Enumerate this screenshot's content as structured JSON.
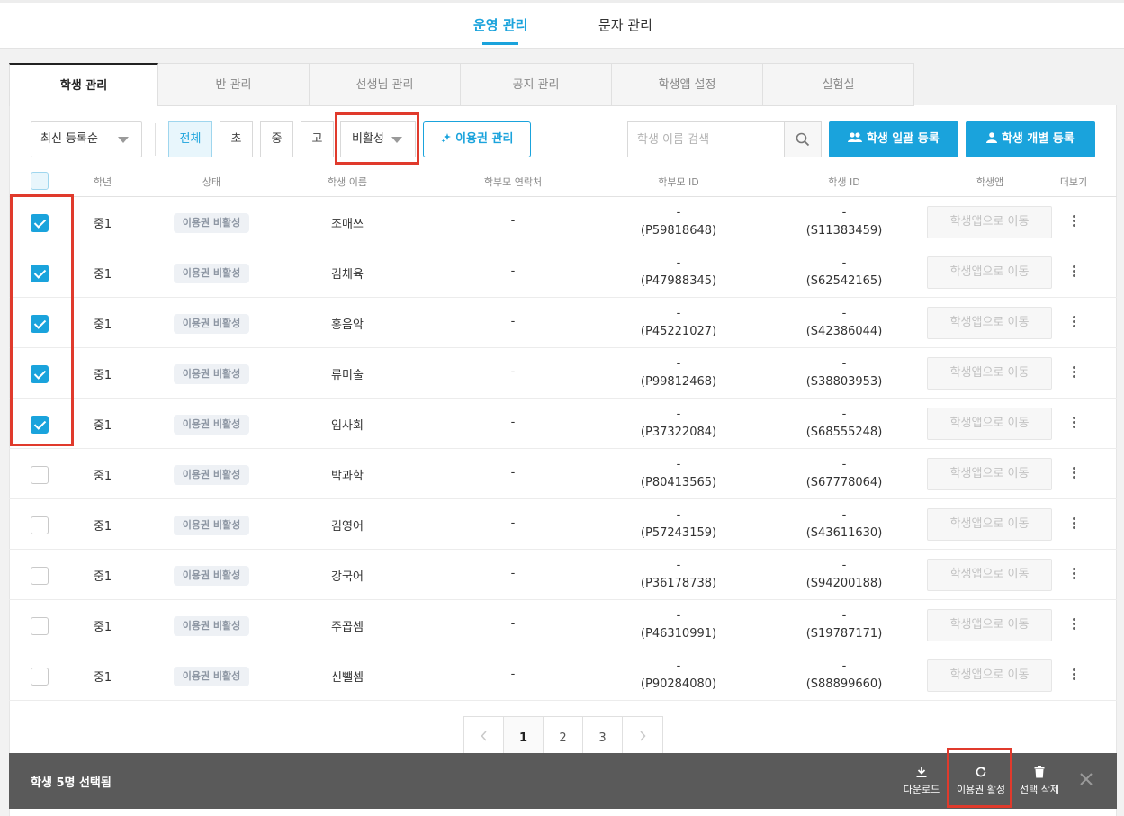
{
  "top_nav": {
    "items": [
      "운영 관리",
      "문자 관리"
    ],
    "active": "운영 관리"
  },
  "tabs": [
    "학생 관리",
    "반 관리",
    "선생님 관리",
    "공지 관리",
    "학생앱 설정",
    "실험실"
  ],
  "toolbar": {
    "sort_value": "최신 등록순",
    "grades": [
      "전체",
      "초",
      "중",
      "고"
    ],
    "status_value": "비활성",
    "pass_button": "이용권 관리",
    "search_placeholder": "학생 이름 검색",
    "bulk_register": "학생 일괄 등록",
    "single_register": "학생 개별 등록"
  },
  "table": {
    "headers": [
      "학년",
      "상태",
      "학생 이름",
      "학부모 연락처",
      "학부모 ID",
      "학생 ID",
      "학생앱",
      "더보기"
    ],
    "rows": [
      {
        "checked": true,
        "grade": "중1",
        "status": "이용권 비활성",
        "name": "조매쓰",
        "parent_phone": "-",
        "parent_id_top": "-",
        "parent_id": "(P59818648)",
        "student_id_top": "-",
        "student_id": "(S11383459)",
        "app_button": "학생앱으로 이동"
      },
      {
        "checked": true,
        "grade": "중1",
        "status": "이용권 비활성",
        "name": "김체육",
        "parent_phone": "-",
        "parent_id_top": "-",
        "parent_id": "(P47988345)",
        "student_id_top": "-",
        "student_id": "(S62542165)",
        "app_button": "학생앱으로 이동"
      },
      {
        "checked": true,
        "grade": "중1",
        "status": "이용권 비활성",
        "name": "홍음악",
        "parent_phone": "-",
        "parent_id_top": "-",
        "parent_id": "(P45221027)",
        "student_id_top": "-",
        "student_id": "(S42386044)",
        "app_button": "학생앱으로 이동"
      },
      {
        "checked": true,
        "grade": "중1",
        "status": "이용권 비활성",
        "name": "류미술",
        "parent_phone": "-",
        "parent_id_top": "-",
        "parent_id": "(P99812468)",
        "student_id_top": "-",
        "student_id": "(S38803953)",
        "app_button": "학생앱으로 이동"
      },
      {
        "checked": true,
        "grade": "중1",
        "status": "이용권 비활성",
        "name": "임사회",
        "parent_phone": "-",
        "parent_id_top": "-",
        "parent_id": "(P37322084)",
        "student_id_top": "-",
        "student_id": "(S68555248)",
        "app_button": "학생앱으로 이동"
      },
      {
        "checked": false,
        "grade": "중1",
        "status": "이용권 비활성",
        "name": "박과학",
        "parent_phone": "-",
        "parent_id_top": "-",
        "parent_id": "(P80413565)",
        "student_id_top": "-",
        "student_id": "(S67778064)",
        "app_button": "학생앱으로 이동"
      },
      {
        "checked": false,
        "grade": "중1",
        "status": "이용권 비활성",
        "name": "김영어",
        "parent_phone": "-",
        "parent_id_top": "-",
        "parent_id": "(P57243159)",
        "student_id_top": "-",
        "student_id": "(S43611630)",
        "app_button": "학생앱으로 이동"
      },
      {
        "checked": false,
        "grade": "중1",
        "status": "이용권 비활성",
        "name": "강국어",
        "parent_phone": "-",
        "parent_id_top": "-",
        "parent_id": "(P36178738)",
        "student_id_top": "-",
        "student_id": "(S94200188)",
        "app_button": "학생앱으로 이동"
      },
      {
        "checked": false,
        "grade": "중1",
        "status": "이용권 비활성",
        "name": "주곱셈",
        "parent_phone": "-",
        "parent_id_top": "-",
        "parent_id": "(P46310991)",
        "student_id_top": "-",
        "student_id": "(S19787171)",
        "app_button": "학생앱으로 이동"
      },
      {
        "checked": false,
        "grade": "중1",
        "status": "이용권 비활성",
        "name": "신뺄셈",
        "parent_phone": "-",
        "parent_id_top": "-",
        "parent_id": "(P90284080)",
        "student_id_top": "-",
        "student_id": "(S88899660)",
        "app_button": "학생앱으로 이동"
      }
    ]
  },
  "pagination": {
    "pages": [
      "1",
      "2",
      "3"
    ],
    "current": "1"
  },
  "action_bar": {
    "count_text": "학생 5명 선택됨",
    "download": "다운로드",
    "activate": "이용권 활성",
    "delete": "선택 삭제"
  },
  "colors": {
    "accent": "#1aa3dc",
    "highlight": "#e03a2c",
    "action_bar": "#5a5a5a"
  },
  "icons": [
    "caret-down-icon",
    "sparkle-icon",
    "search-icon",
    "users-icon",
    "user-icon",
    "kebab-icon",
    "chevron-left-icon",
    "chevron-right-icon",
    "download-icon",
    "refresh-icon",
    "trash-icon",
    "close-icon"
  ]
}
